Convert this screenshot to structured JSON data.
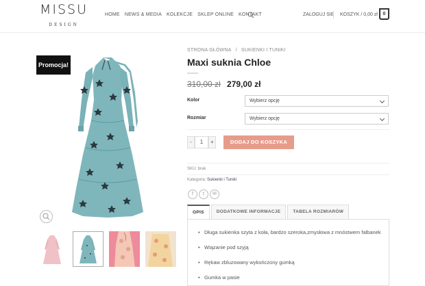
{
  "header": {
    "logo_main": "MISSU",
    "logo_sub": "DESIGN",
    "nav": [
      "HOME",
      "NEWS & MEDIA",
      "KOLEKCJE",
      "SKLEP ONLINE",
      "KONTAKT"
    ],
    "login": "ZALOGUJ SIĘ",
    "cart_label": "KOSZYK / 0,00 zł",
    "cart_count": "0"
  },
  "gallery": {
    "promo_badge": "Promocja!",
    "thumbnails": [
      "thumb-pink-dress",
      "thumb-blue-dress",
      "thumb-floral-pink",
      "thumb-floral-yellow"
    ]
  },
  "product": {
    "breadcrumb": [
      "STRONA GŁÓWNA",
      "/",
      "SUKIENKI I TUNIKI"
    ],
    "title": "Maxi suknia Chloe",
    "old_price": "310,00 zł",
    "new_price": "279,00 zł",
    "variations": [
      {
        "label": "Kolor",
        "value": "Wybierz opcję"
      },
      {
        "label": "Rozmiar",
        "value": "Wybierz opcję"
      }
    ],
    "quantity": "1",
    "qty_minus": "-",
    "qty_plus": "+",
    "add_to_cart": "DODAJ DO KOSZYKA",
    "sku": "SKU: brak",
    "category_prefix": "Kategoria: ",
    "category": "Sukienki i Tuniki",
    "social": [
      "f",
      "t",
      "✉"
    ]
  },
  "tabs": [
    "OPIS",
    "DODATKOWE INFORMACJE",
    "TABELA ROZMIARÓW"
  ],
  "description": [
    "Długa sukienka szyta z koła, bardzo szeroka,zmysłowa z mnóstwem falbanek",
    "Wiązanie pod szyją",
    "Rękaw zbluzowany wykończony gumką",
    "Gumka w pasie"
  ],
  "colors": {
    "accent": "#e79c8b",
    "dress": "#7fb6bc",
    "promo_bg": "#111111"
  }
}
